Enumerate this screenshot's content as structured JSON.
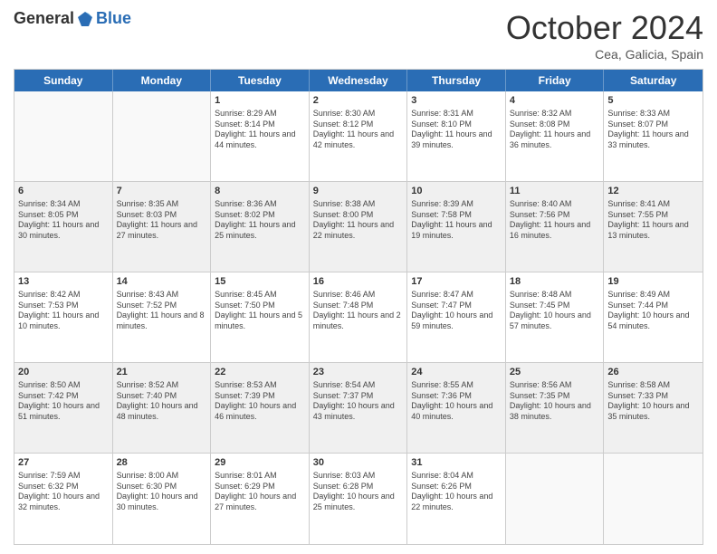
{
  "logo": {
    "general": "General",
    "blue": "Blue"
  },
  "title": "October 2024",
  "subtitle": "Cea, Galicia, Spain",
  "header_days": [
    "Sunday",
    "Monday",
    "Tuesday",
    "Wednesday",
    "Thursday",
    "Friday",
    "Saturday"
  ],
  "weeks": [
    [
      {
        "day": "",
        "empty": true
      },
      {
        "day": "",
        "empty": true
      },
      {
        "day": "1",
        "sunrise": "Sunrise: 8:29 AM",
        "sunset": "Sunset: 8:14 PM",
        "daylight": "Daylight: 11 hours and 44 minutes."
      },
      {
        "day": "2",
        "sunrise": "Sunrise: 8:30 AM",
        "sunset": "Sunset: 8:12 PM",
        "daylight": "Daylight: 11 hours and 42 minutes."
      },
      {
        "day": "3",
        "sunrise": "Sunrise: 8:31 AM",
        "sunset": "Sunset: 8:10 PM",
        "daylight": "Daylight: 11 hours and 39 minutes."
      },
      {
        "day": "4",
        "sunrise": "Sunrise: 8:32 AM",
        "sunset": "Sunset: 8:08 PM",
        "daylight": "Daylight: 11 hours and 36 minutes."
      },
      {
        "day": "5",
        "sunrise": "Sunrise: 8:33 AM",
        "sunset": "Sunset: 8:07 PM",
        "daylight": "Daylight: 11 hours and 33 minutes."
      }
    ],
    [
      {
        "day": "6",
        "sunrise": "Sunrise: 8:34 AM",
        "sunset": "Sunset: 8:05 PM",
        "daylight": "Daylight: 11 hours and 30 minutes.",
        "shaded": true
      },
      {
        "day": "7",
        "sunrise": "Sunrise: 8:35 AM",
        "sunset": "Sunset: 8:03 PM",
        "daylight": "Daylight: 11 hours and 27 minutes.",
        "shaded": true
      },
      {
        "day": "8",
        "sunrise": "Sunrise: 8:36 AM",
        "sunset": "Sunset: 8:02 PM",
        "daylight": "Daylight: 11 hours and 25 minutes.",
        "shaded": true
      },
      {
        "day": "9",
        "sunrise": "Sunrise: 8:38 AM",
        "sunset": "Sunset: 8:00 PM",
        "daylight": "Daylight: 11 hours and 22 minutes.",
        "shaded": true
      },
      {
        "day": "10",
        "sunrise": "Sunrise: 8:39 AM",
        "sunset": "Sunset: 7:58 PM",
        "daylight": "Daylight: 11 hours and 19 minutes.",
        "shaded": true
      },
      {
        "day": "11",
        "sunrise": "Sunrise: 8:40 AM",
        "sunset": "Sunset: 7:56 PM",
        "daylight": "Daylight: 11 hours and 16 minutes.",
        "shaded": true
      },
      {
        "day": "12",
        "sunrise": "Sunrise: 8:41 AM",
        "sunset": "Sunset: 7:55 PM",
        "daylight": "Daylight: 11 hours and 13 minutes.",
        "shaded": true
      }
    ],
    [
      {
        "day": "13",
        "sunrise": "Sunrise: 8:42 AM",
        "sunset": "Sunset: 7:53 PM",
        "daylight": "Daylight: 11 hours and 10 minutes."
      },
      {
        "day": "14",
        "sunrise": "Sunrise: 8:43 AM",
        "sunset": "Sunset: 7:52 PM",
        "daylight": "Daylight: 11 hours and 8 minutes."
      },
      {
        "day": "15",
        "sunrise": "Sunrise: 8:45 AM",
        "sunset": "Sunset: 7:50 PM",
        "daylight": "Daylight: 11 hours and 5 minutes."
      },
      {
        "day": "16",
        "sunrise": "Sunrise: 8:46 AM",
        "sunset": "Sunset: 7:48 PM",
        "daylight": "Daylight: 11 hours and 2 minutes."
      },
      {
        "day": "17",
        "sunrise": "Sunrise: 8:47 AM",
        "sunset": "Sunset: 7:47 PM",
        "daylight": "Daylight: 10 hours and 59 minutes."
      },
      {
        "day": "18",
        "sunrise": "Sunrise: 8:48 AM",
        "sunset": "Sunset: 7:45 PM",
        "daylight": "Daylight: 10 hours and 57 minutes."
      },
      {
        "day": "19",
        "sunrise": "Sunrise: 8:49 AM",
        "sunset": "Sunset: 7:44 PM",
        "daylight": "Daylight: 10 hours and 54 minutes."
      }
    ],
    [
      {
        "day": "20",
        "sunrise": "Sunrise: 8:50 AM",
        "sunset": "Sunset: 7:42 PM",
        "daylight": "Daylight: 10 hours and 51 minutes.",
        "shaded": true
      },
      {
        "day": "21",
        "sunrise": "Sunrise: 8:52 AM",
        "sunset": "Sunset: 7:40 PM",
        "daylight": "Daylight: 10 hours and 48 minutes.",
        "shaded": true
      },
      {
        "day": "22",
        "sunrise": "Sunrise: 8:53 AM",
        "sunset": "Sunset: 7:39 PM",
        "daylight": "Daylight: 10 hours and 46 minutes.",
        "shaded": true
      },
      {
        "day": "23",
        "sunrise": "Sunrise: 8:54 AM",
        "sunset": "Sunset: 7:37 PM",
        "daylight": "Daylight: 10 hours and 43 minutes.",
        "shaded": true
      },
      {
        "day": "24",
        "sunrise": "Sunrise: 8:55 AM",
        "sunset": "Sunset: 7:36 PM",
        "daylight": "Daylight: 10 hours and 40 minutes.",
        "shaded": true
      },
      {
        "day": "25",
        "sunrise": "Sunrise: 8:56 AM",
        "sunset": "Sunset: 7:35 PM",
        "daylight": "Daylight: 10 hours and 38 minutes.",
        "shaded": true
      },
      {
        "day": "26",
        "sunrise": "Sunrise: 8:58 AM",
        "sunset": "Sunset: 7:33 PM",
        "daylight": "Daylight: 10 hours and 35 minutes.",
        "shaded": true
      }
    ],
    [
      {
        "day": "27",
        "sunrise": "Sunrise: 7:59 AM",
        "sunset": "Sunset: 6:32 PM",
        "daylight": "Daylight: 10 hours and 32 minutes."
      },
      {
        "day": "28",
        "sunrise": "Sunrise: 8:00 AM",
        "sunset": "Sunset: 6:30 PM",
        "daylight": "Daylight: 10 hours and 30 minutes."
      },
      {
        "day": "29",
        "sunrise": "Sunrise: 8:01 AM",
        "sunset": "Sunset: 6:29 PM",
        "daylight": "Daylight: 10 hours and 27 minutes."
      },
      {
        "day": "30",
        "sunrise": "Sunrise: 8:03 AM",
        "sunset": "Sunset: 6:28 PM",
        "daylight": "Daylight: 10 hours and 25 minutes."
      },
      {
        "day": "31",
        "sunrise": "Sunrise: 8:04 AM",
        "sunset": "Sunset: 6:26 PM",
        "daylight": "Daylight: 10 hours and 22 minutes."
      },
      {
        "day": "",
        "empty": true
      },
      {
        "day": "",
        "empty": true
      }
    ]
  ]
}
